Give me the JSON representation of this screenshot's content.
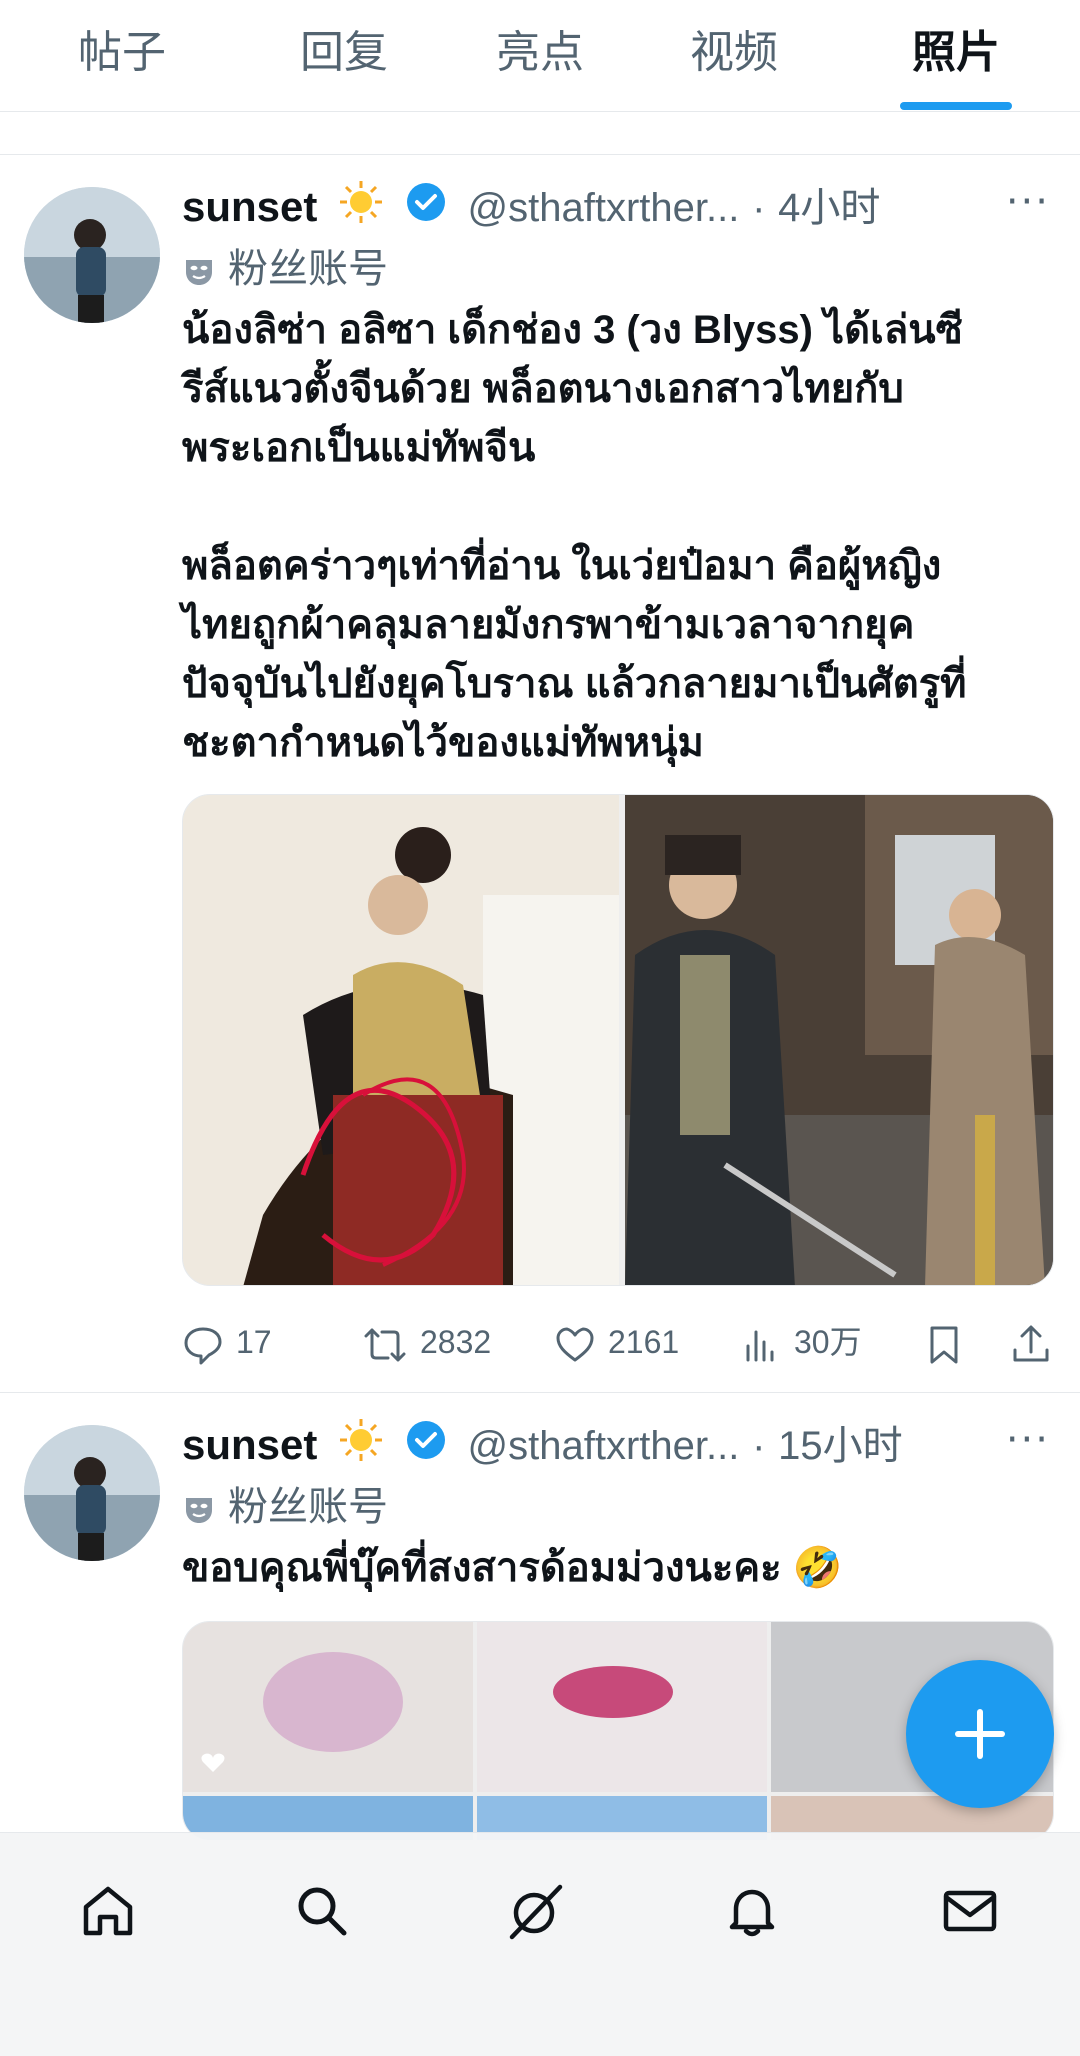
{
  "tabs": [
    "帖子",
    "回复",
    "亮点",
    "视频",
    "照片"
  ],
  "active_tab": "照片",
  "accent": "#1d9bf0",
  "posts": [
    {
      "name": "sunset",
      "handle": "@sthaftxrther...",
      "dot": "·",
      "time": "4小时",
      "more": "···",
      "fan_label": "粉丝账号",
      "text1": "น้องลิซ่า อลิซา เด็กช่อง 3 (วง Blyss) ได้เล่นซี\nรีส์แนวตั้งจีนด้วย พล็อตนางเอกสาวไทยกับ\nพระเอกเป็นแม่ทัพจีน",
      "text2": "พล็อตคร่าวๆเท่าที่อ่าน ในเว่ยป๋อมา คือผู้หญิง\nไทยถูกผ้าคลุมลายมังกรพาข้ามเวลาจากยุค\nปัจจุบันไปยังยุคโบราณ แล้วกลายมาเป็นศัตรูที่\nชะตากำหนดไว้ของแม่ทัพหนุ่ม",
      "replies": "17",
      "reposts": "2832",
      "likes": "2161",
      "views": "30万"
    },
    {
      "name": "sunset",
      "handle": "@sthaftxrther...",
      "dot": "·",
      "time": "15小时",
      "more": "···",
      "fan_label": "粉丝账号",
      "text1": "ขอบคุณพี่บุ๊คที่สงสารด้อมม่วงนะคะ 🤣"
    }
  ],
  "icons": {
    "reply": "reply-icon",
    "repost": "repost-icon",
    "like": "heart-icon",
    "views": "views-icon",
    "bookmark": "bookmark-icon",
    "share": "share-icon",
    "fab": "plus-icon",
    "nav": [
      "home-icon",
      "search-icon",
      "grok-icon",
      "bell-icon",
      "mail-icon"
    ]
  }
}
